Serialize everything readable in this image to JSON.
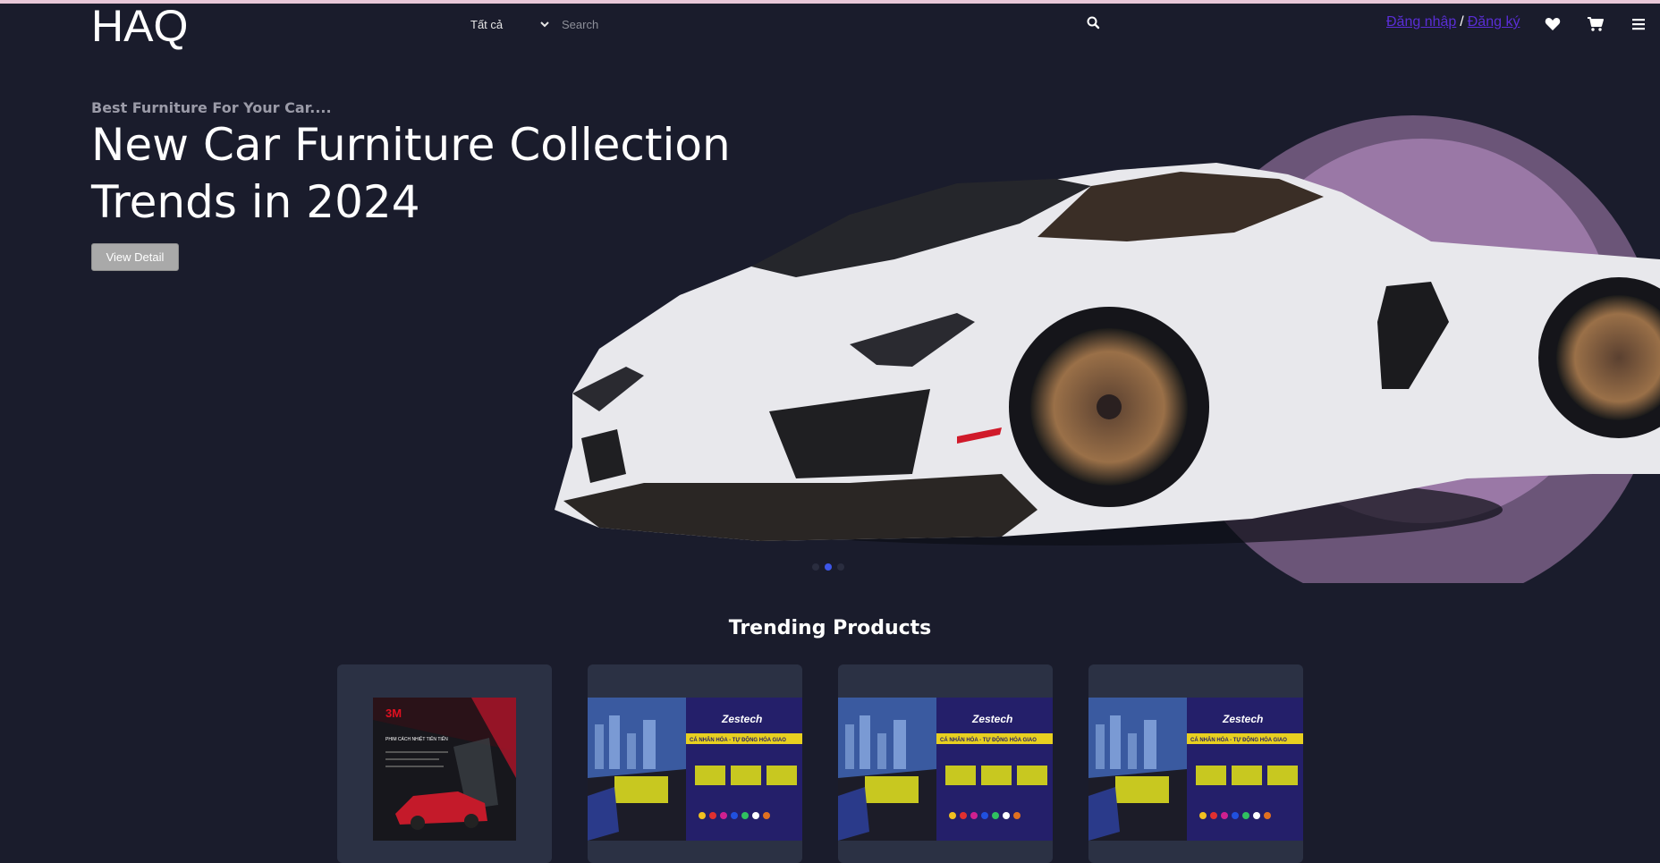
{
  "header": {
    "logo": "HAQ",
    "category_selected": "Tất cả",
    "search_placeholder": "Search",
    "login_label": "Đăng nhập",
    "separator": "/",
    "register_label": "Đăng ký",
    "icons": [
      "search-icon",
      "heart-icon",
      "cart-icon",
      "menu-icon"
    ],
    "login_link_color": "#5a2ed6"
  },
  "hero": {
    "subtitle": "Best Furniture For Your Car....",
    "title": "New Car Furniture Collection Trends in 2024",
    "button_label": "View Detail",
    "accent_circle_color": "#9a78a6",
    "active_slide": 2,
    "slide_count": 3
  },
  "trending": {
    "title": "Trending Products",
    "products": [
      {
        "brand": "3M",
        "image_text": "PHIM CÁCH NHIỆT TIÊN TIẾN"
      },
      {
        "brand": "Zestech",
        "image_text": "CÁ NHÂN HÓA - TỰ ĐỘNG HÓA GIAO"
      },
      {
        "brand": "Zestech",
        "image_text": "CÁ NHÂN HÓA - TỰ ĐỘNG HÓA GIAO"
      },
      {
        "brand": "Zestech",
        "image_text": "CÁ NHÂN HÓA - TỰ ĐỘNG HÓA GIAO"
      }
    ]
  },
  "colors": {
    "background": "#1a1c2c",
    "card": "#2b3144",
    "dot_active": "#3d56e8"
  }
}
